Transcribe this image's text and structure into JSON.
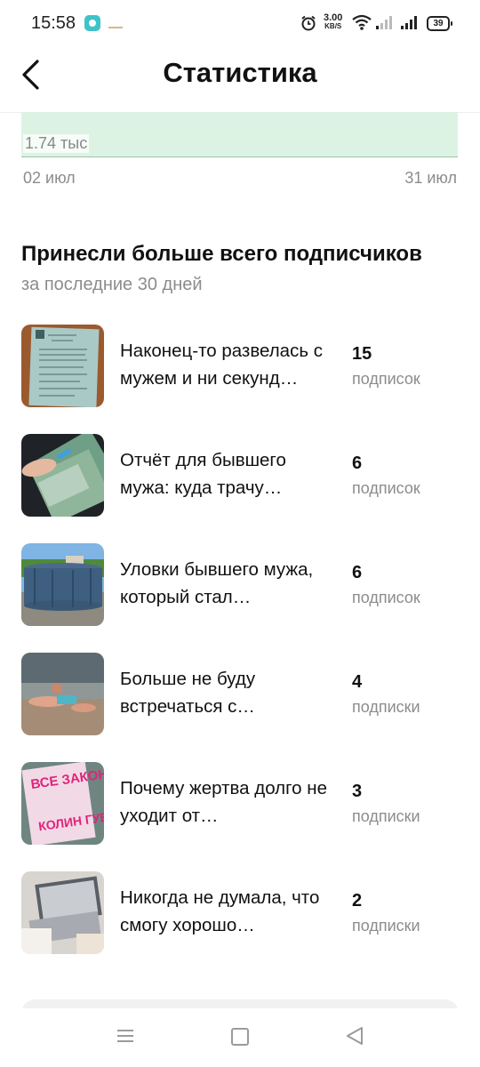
{
  "status_bar": {
    "time": "15:58",
    "net_speed": "3.00",
    "net_unit": "KB/S",
    "battery": "39"
  },
  "header": {
    "title": "Статистика"
  },
  "chart": {
    "value_label": "1.74 тыс",
    "x_start": "02 июл",
    "x_end": "31 июл"
  },
  "section": {
    "title": "Принесли больше всего подписчиков",
    "subtitle": "за последние 30 дней"
  },
  "items": [
    {
      "title": "Наконец-то развелась с мужем и ни секунд…",
      "count": "15",
      "unit": "подписок"
    },
    {
      "title": "Отчёт для бывшего мужа: куда трачу…",
      "count": "6",
      "unit": "подписок"
    },
    {
      "title": "Уловки бывшего мужа, который стал…",
      "count": "6",
      "unit": "подписок"
    },
    {
      "title": "Больше не буду встречаться с…",
      "count": "4",
      "unit": "подписки"
    },
    {
      "title": "Почему жертва долго не уходит от…",
      "count": "3",
      "unit": "подписки"
    },
    {
      "title": "Никогда не думала, что смогу хорошо…",
      "count": "2",
      "unit": "подписки"
    }
  ],
  "thumbnails": {
    "thumb1": "ВСЕ ЗАКОНЧИТСЯ НА НАС",
    "thumb2": "КОЛИН ГУВЕР"
  }
}
